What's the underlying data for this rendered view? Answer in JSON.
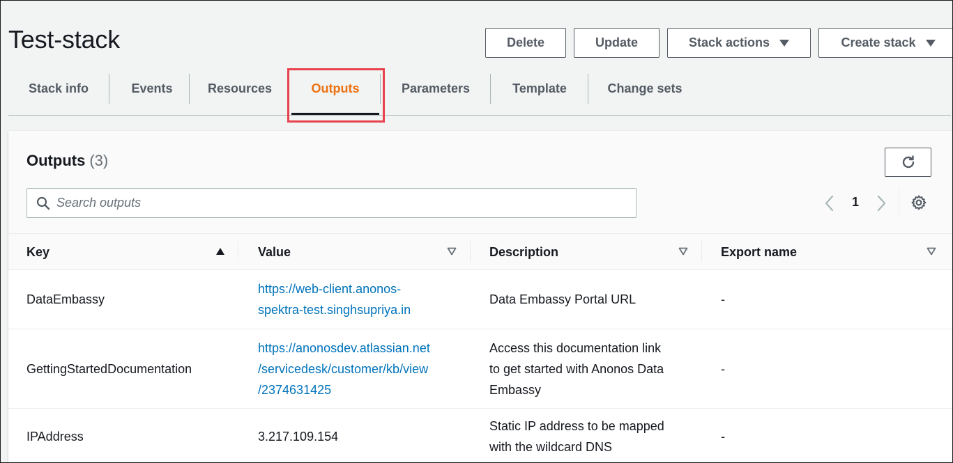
{
  "page": {
    "title": "Test-stack"
  },
  "actions": {
    "delete_label": "Delete",
    "update_label": "Update",
    "stack_actions_label": "Stack actions",
    "create_stack_label": "Create stack"
  },
  "tabs": [
    {
      "label": "Stack info"
    },
    {
      "label": "Events"
    },
    {
      "label": "Resources"
    },
    {
      "label": "Outputs",
      "active": true
    },
    {
      "label": "Parameters"
    },
    {
      "label": "Template"
    },
    {
      "label": "Change sets"
    }
  ],
  "outputs": {
    "title": "Outputs",
    "count": "(3)",
    "search_placeholder": "Search outputs",
    "page": "1",
    "columns": {
      "key": "Key",
      "value": "Value",
      "description": "Description",
      "export_name": "Export name"
    },
    "rows": [
      {
        "key": "DataEmbassy",
        "value_lines": [
          "https://web-client.anonos-",
          "spektra-test.singhsupriya.in"
        ],
        "description_lines": [
          "Data Embassy Portal URL"
        ],
        "export_name": "-"
      },
      {
        "key": "GettingStartedDocumentation",
        "value_lines": [
          "https://anonosdev.atlassian.net",
          "/servicedesk/customer/kb/view",
          "/2374631425"
        ],
        "description_lines": [
          "Access this documentation link",
          "to get started with Anonos Data",
          "Embassy"
        ],
        "export_name": "-"
      },
      {
        "key": "IPAddress",
        "value_lines": [
          "3.217.109.154"
        ],
        "description_lines": [
          "Static IP address to be mapped",
          "with the wildcard DNS"
        ],
        "export_name": "-"
      }
    ]
  },
  "colors": {
    "accent": "#ec7211",
    "link": "#0073bb",
    "highlight": "#e8424d"
  }
}
